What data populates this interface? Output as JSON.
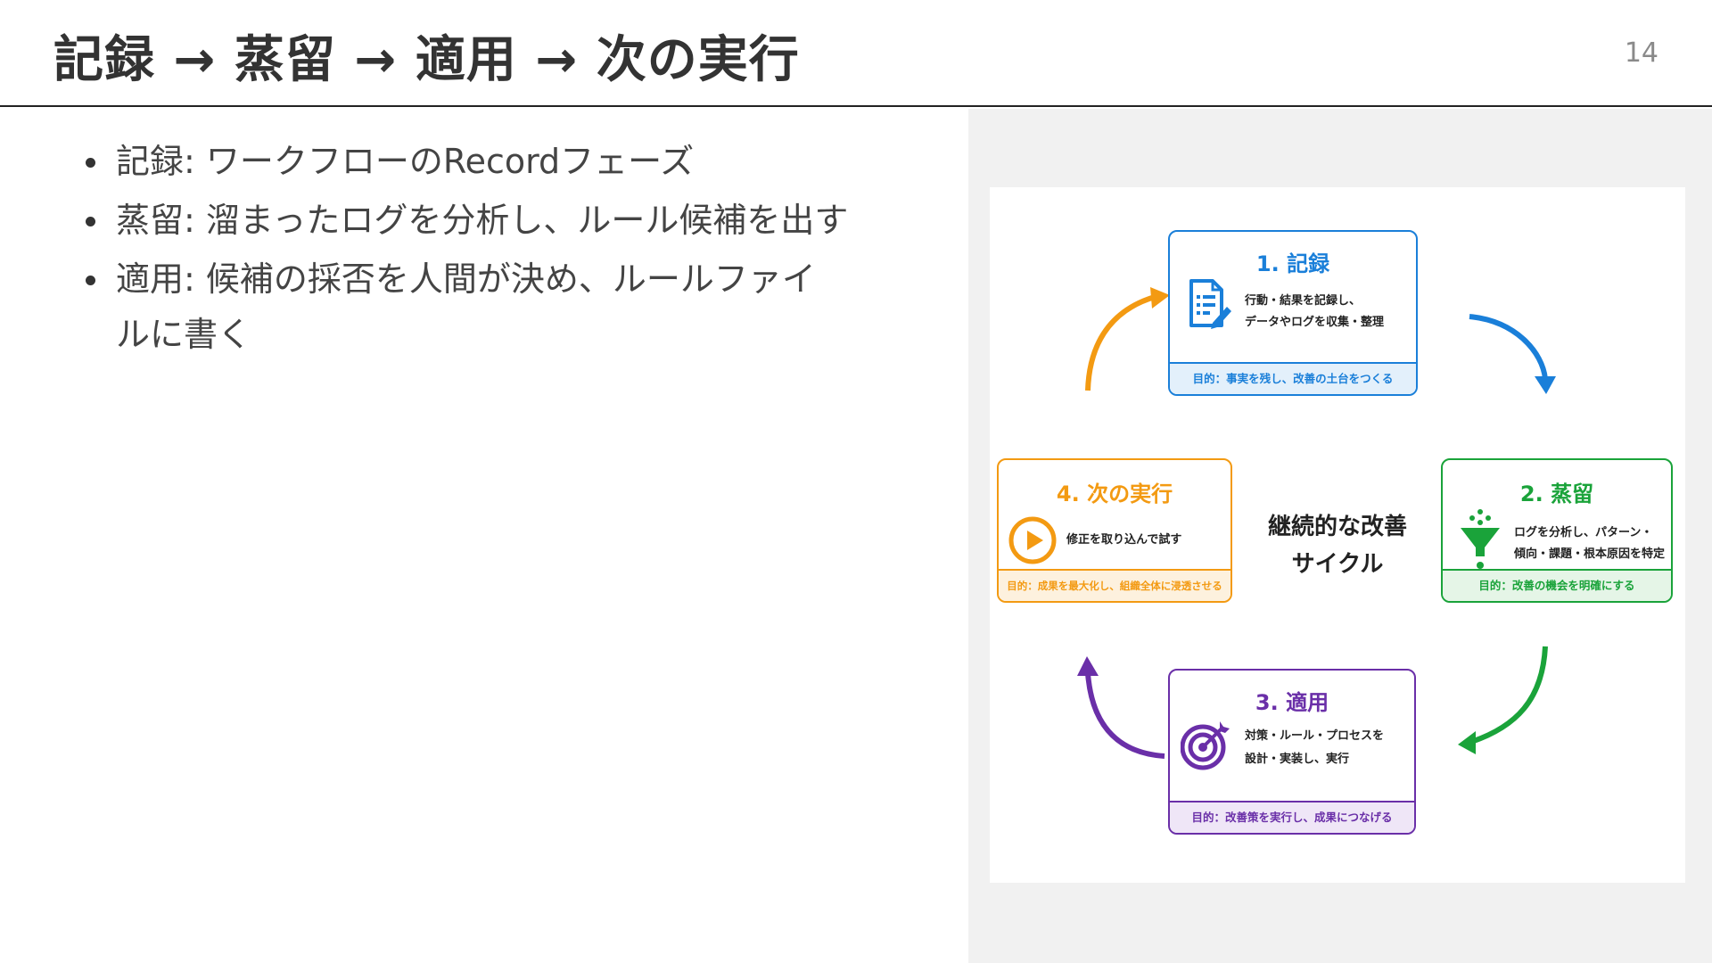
{
  "slide": {
    "title": "記録 → 蒸留 → 適用 → 次の実行",
    "page_number": "14"
  },
  "bullets": [
    "記録: ワークフローのRecordフェーズ",
    "蒸留: 溜まったログを分析し、ルール候補を出す",
    "適用: 候補の採否を人間が決め、ルールファイルに書く"
  ],
  "diagram": {
    "center_label_line1": "継続的な改善",
    "center_label_line2": "サイクル",
    "stages": [
      {
        "title": "1. 記録",
        "desc_line1": "行動・結果を記録し、",
        "desc_line2": "データやログを収集・整理",
        "purpose": "目的：事実を残し、改善の土台をつくる",
        "icon": "document-edit-icon",
        "color": "#1a7fd9",
        "purpose_bg": "#e3f0fb"
      },
      {
        "title": "2. 蒸留",
        "desc_line1": "ログを分析し、パターン・",
        "desc_line2": "傾向・課題・根本原因を特定",
        "purpose": "目的：改善の機会を明確にする",
        "icon": "funnel-icon",
        "color": "#1aa33a",
        "purpose_bg": "#e5f5e7"
      },
      {
        "title": "3. 適用",
        "desc_line1": "対策・ルール・プロセスを",
        "desc_line2": "設計・実装し、実行",
        "purpose": "目的：改善策を実行し、成果につなげる",
        "icon": "target-icon",
        "color": "#6a2fa8",
        "purpose_bg": "#efe6f7"
      },
      {
        "title": "4. 次の実行",
        "desc_line1": "修正を取り込んで試す",
        "desc_line2": "",
        "purpose": "目的：成果を最大化し、組織全体に浸透させる",
        "icon": "play-icon",
        "color": "#f39a12",
        "purpose_bg": "#fdf1de"
      }
    ]
  }
}
